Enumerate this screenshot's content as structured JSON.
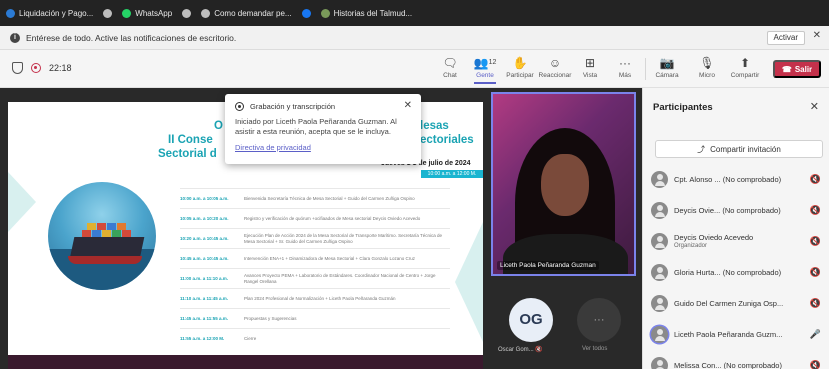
{
  "bookmarks": [
    {
      "label": "Liquidación y Pago...",
      "color": "#2b7bd5"
    },
    {
      "label": "",
      "color": "#bdbdbd"
    },
    {
      "label": "WhatsApp",
      "color": "#25d366"
    },
    {
      "label": "",
      "color": "#bdbdbd"
    },
    {
      "label": "Como demandar pe...",
      "color": "#bdbdbd"
    },
    {
      "label": "",
      "color": "#1877f2"
    },
    {
      "label": "Historias del Talmud...",
      "color": "#7a9a5a"
    }
  ],
  "notification": {
    "text": "Entérese de todo. Active las notificaciones de escritorio.",
    "activate_label": "Activar",
    "close_glyph": "✕"
  },
  "toolbar": {
    "timer": "22:18",
    "buttons": [
      {
        "name": "chat",
        "icon": "chat-icon",
        "glyph": "🗨",
        "label": "Chat"
      },
      {
        "name": "people",
        "icon": "people-icon",
        "glyph": "👥",
        "label": "Gente",
        "count": "12"
      },
      {
        "name": "raise",
        "icon": "hand-icon",
        "glyph": "✋",
        "label": "Participar"
      },
      {
        "name": "react",
        "icon": "smile-icon",
        "glyph": "☺",
        "label": "Reaccionar"
      },
      {
        "name": "view",
        "icon": "grid-icon",
        "glyph": "⊞",
        "label": "Vista"
      },
      {
        "name": "more",
        "icon": "more-icon",
        "glyph": "···",
        "label": "Más"
      },
      {
        "name": "camera",
        "icon": "camera-off-icon",
        "glyph": "📷",
        "label": "Cámara"
      },
      {
        "name": "mic",
        "icon": "mic-off-icon",
        "glyph": "🎙",
        "label": "Micro"
      },
      {
        "name": "share",
        "icon": "share-icon",
        "glyph": "⬆",
        "label": "Compartir"
      }
    ],
    "leave_label": "Salir",
    "leave_color": "#c4314b"
  },
  "slide": {
    "title_1": "O",
    "title_1b": "lesas",
    "title_2": "II Conse",
    "title_2b": "ectoriales",
    "title_3": "Sectorial d",
    "date": "Jueves   1   1   de julio de 2024",
    "date_badge": "10:00 a.m. a 12:00 M.",
    "schedule": [
      {
        "time": "10:00 a.m. a 10:05 a.m.",
        "desc": "Bienvenida Secretaría Técnica de Mesa Sectorial + Guido del Carmen Zuñiga Ospino"
      },
      {
        "time": "10:05 a.m. a 10:20 a.m.",
        "desc": "Registro y verificación de quórum +ocifiaados de Mesa sectorial Deycis Oviedo Acevedo"
      },
      {
        "time": "10:20 a.m. a 10:45 a.m.",
        "desc": "Ejecución Plan de Acción 2024 de la Mesa Sectorial de Transporte Marítimo. Secretaría Técnica de Mesa Sectorial + Sr. Guido del Carmen Zuñiga Ospino"
      },
      {
        "time": "10:45 a.m. a 10:45 a.m.",
        "desc": "Intervención ENA+1 + Dinamizadora de Mesa Sectorial + Clara Gonzalo Lozano Cruz"
      },
      {
        "time": "11:00 a.m. a 11:10 a.m.",
        "desc": "Avances Proyecto PEMA + Laboratorio de Estándares. Coordinador Nacional de Centro + Jorge Rangel Orellana"
      },
      {
        "time": "11:10 a.m. a 11:45 a.m.",
        "desc": "Plan 2024 Profesional de Normalización + Liceth Paola Peñaranda Guzmán"
      },
      {
        "time": "11:45 a.m. a 11:55 a.m.",
        "desc": "Propuestas y Sugerencias"
      },
      {
        "time": "11:55 a.m. a 12:00 M.",
        "desc": "Cierre"
      }
    ]
  },
  "popup": {
    "title": "Grabación y transcripción",
    "body": "Iniciado por Liceth Paola Peñaranda Guzman. Al asistir a esta reunión, acepta que se le incluya.",
    "link": "Directiva de privacidad",
    "close_glyph": "✕"
  },
  "video": {
    "name": "Liceth Paola Peñaranda Guzman"
  },
  "tiles": {
    "og_initials": "OG",
    "og_name": "Oscar Gom...",
    "more_glyph": "···",
    "more_label": "Ver todos"
  },
  "panel": {
    "title": "Participantes",
    "close_glyph": "✕",
    "share_label": "Compartir invitación",
    "participants": [
      {
        "name": "Cpt. Alonso ... (No comprobado)",
        "role": "",
        "mic": "🔇"
      },
      {
        "name": "Deycis Ovie... (No comprobado)",
        "role": "",
        "mic": "🔇"
      },
      {
        "name": "Deycis Oviedo Acevedo",
        "role": "Organizador",
        "mic": "🔇"
      },
      {
        "name": "Gloria Hurta... (No comprobado)",
        "role": "",
        "mic": "🔇"
      },
      {
        "name": "Guido Del Carmen Zuniga Osp...",
        "role": "",
        "mic": "🔇"
      },
      {
        "name": "Liceth Paola Peñaranda Guzm...",
        "role": "",
        "mic": "🎤",
        "active": true
      },
      {
        "name": "Melissa Con... (No comprobado)",
        "role": "",
        "mic": "🔇"
      }
    ]
  }
}
